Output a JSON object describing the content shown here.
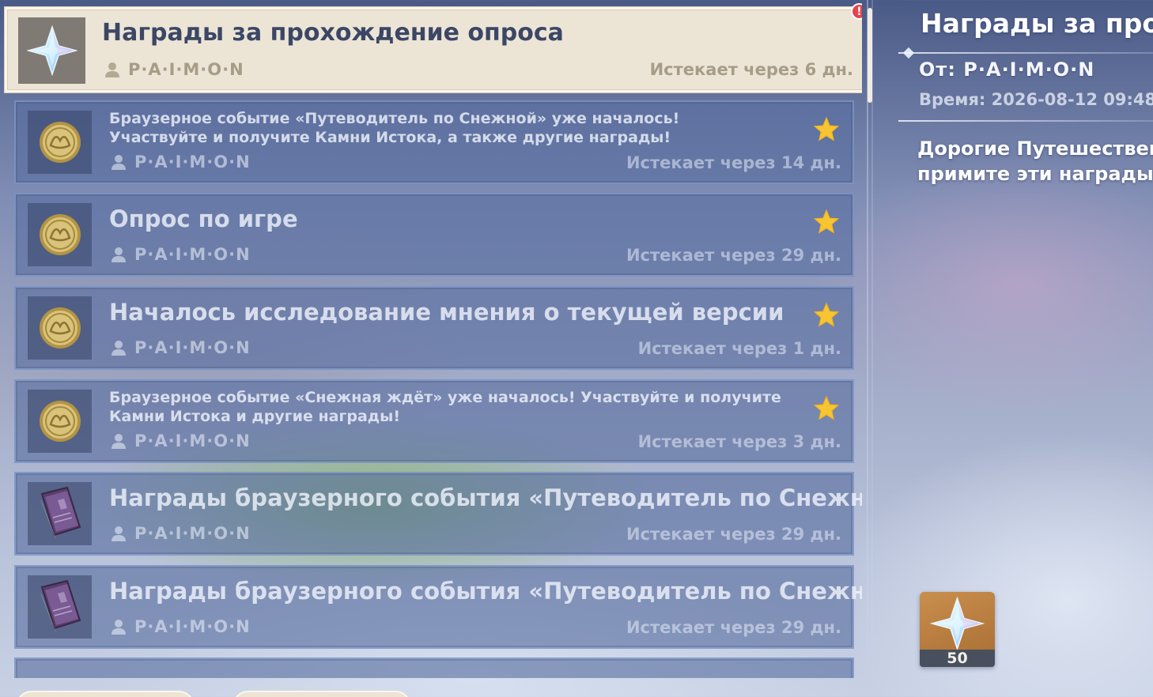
{
  "mail_list": {
    "selected": {
      "title": "Награды за прохождение опроса",
      "sender": "P·A·I·M·O·N",
      "expires": "Истекает через 6 дн.",
      "icon": "primogem-icon",
      "unread_badge": "!"
    },
    "items": [
      {
        "title": "Браузерное событие «Путеводитель по Снежной» уже началось! Участвуйте и получите Камни Истока, а также другие награды!",
        "sender": "P·A·I·M·O·N",
        "expires": "Истекает через 14 дн.",
        "icon": "coin-icon",
        "starred": true
      },
      {
        "title": "Опрос по игре",
        "sender": "P·A·I·M·O·N",
        "expires": "Истекает через 29 дн.",
        "icon": "coin-icon",
        "starred": true
      },
      {
        "title": "Началось исследование мнения о текущей версии",
        "sender": "P·A·I·M·O·N",
        "expires": "Истекает через 1 дн.",
        "icon": "coin-icon",
        "starred": true
      },
      {
        "title": "Браузерное событие «Снежная ждёт» уже началось! Участвуйте и получите Камни Истока и другие награды!",
        "sender": "P·A·I·M·O·N",
        "expires": "Истекает через 3 дн.",
        "icon": "coin-icon",
        "starred": true
      },
      {
        "title": "Награды браузерного события «Путеводитель по Снежной»",
        "sender": "P·A·I·M·O·N",
        "expires": "Истекает через 29 дн.",
        "icon": "book-icon",
        "starred": false
      },
      {
        "title": "Награды браузерного события «Путеводитель по Снежной»",
        "sender": "P·A·I·M·O·N",
        "expires": "Истекает через 29 дн.",
        "icon": "book-icon",
        "starred": false
      },
      {
        "title": "",
        "icon": "primogem-icon",
        "partial": true
      }
    ]
  },
  "bottom_buttons": [
    {
      "label": ""
    },
    {
      "label": ""
    }
  ],
  "detail": {
    "title": "Награды за прох",
    "from_label": "От:",
    "from_value": "P·A·I·M·O·N",
    "time_label": "Время:",
    "time_value": "2026-08-12 09:48",
    "body_line1": "Дорогие Путешествен",
    "body_line2": "примите эти награды",
    "reward": {
      "icon": "primogem-icon",
      "count": "50"
    }
  },
  "colors": {
    "selected_bg": "#ece5d6",
    "selected_text": "#3c4766",
    "star": "#f7c531",
    "badge": "#e5454c",
    "reward_bg": "#c98f4e"
  }
}
